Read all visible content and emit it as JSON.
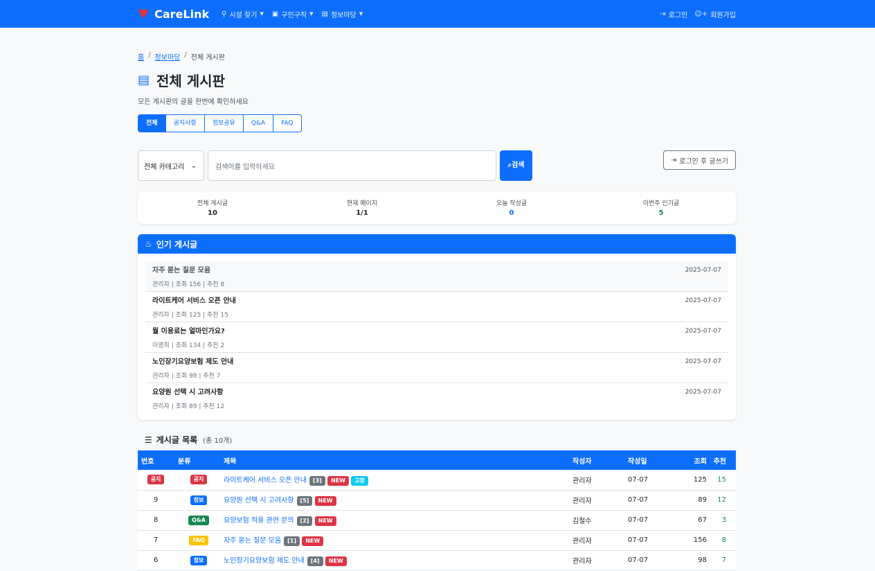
{
  "nav": {
    "brand": "CareLink",
    "items": [
      {
        "label": "시설 찾기"
      },
      {
        "label": "구인구직"
      },
      {
        "label": "정보마당"
      }
    ],
    "login": "로그인",
    "signup": "회원가입"
  },
  "breadcrumb": [
    "홈",
    "정보마당",
    "전체 게시판"
  ],
  "page": {
    "title": "전체 게시판",
    "subtitle": "모든 게시판의 글을 한번에 확인하세요"
  },
  "tabs": [
    "전체",
    "공지사항",
    "정보공유",
    "Q&A",
    "FAQ"
  ],
  "search": {
    "category": "전체 카테고리",
    "placeholder": "검색어를 입력하세요",
    "button": "검색"
  },
  "write_button": "로그인 후 글쓰기",
  "stats": [
    {
      "label": "전체 게시글",
      "value": "10",
      "color": "#212529"
    },
    {
      "label": "현재 페이지",
      "value": "1/1",
      "color": "#212529"
    },
    {
      "label": "오늘 작성글",
      "value": "0",
      "color": "#0d6efd"
    },
    {
      "label": "이번주 인기글",
      "value": "5",
      "color": "#198754"
    }
  ],
  "popular": {
    "title": "인기 게시글",
    "items": [
      {
        "title": "자주 묻는 질문 모음",
        "meta": "관리자 | 조회 156 | 추천 8",
        "date": "2025-07-07"
      },
      {
        "title": "라이트케어 서비스 오픈 안내",
        "meta": "관리자 | 조회 125 | 추천 15",
        "date": "2025-07-07"
      },
      {
        "title": "월 이용료는 얼마인가요?",
        "meta": "이영희 | 조회 134 | 추천 2",
        "date": "2025-07-07"
      },
      {
        "title": "노인장기요양보험 제도 안내",
        "meta": "관리자 | 조회 98 | 추천 7",
        "date": "2025-07-07"
      },
      {
        "title": "요양원 선택 시 고려사항",
        "meta": "관리자 | 조회 89 | 추천 12",
        "date": "2025-07-07"
      }
    ]
  },
  "list": {
    "title": "게시글 목록",
    "count": "(총 10개)",
    "columns": [
      "번호",
      "분류",
      "제목",
      "작성자",
      "작성일",
      "조회",
      "추천"
    ],
    "rows": [
      {
        "num": "공지",
        "num_badge": true,
        "cat": "공지",
        "cat_color": "red",
        "title": "라이트케어 서비스 오픈 안내",
        "comments": "[3]",
        "new": "NEW",
        "extra": "고정",
        "author": "관리자",
        "date": "07-07",
        "views": "125",
        "likes": "15"
      },
      {
        "num": "9",
        "num_badge": false,
        "cat": "정보",
        "cat_color": "blue",
        "title": "요양원 선택 시 고려사항",
        "comments": "[5]",
        "new": "NEW",
        "extra": "",
        "author": "관리자",
        "date": "07-07",
        "views": "89",
        "likes": "12"
      },
      {
        "num": "8",
        "num_badge": false,
        "cat": "Q&A",
        "cat_color": "green",
        "title": "요양보험 적용 관련 문의",
        "comments": "[2]",
        "new": "NEW",
        "extra": "",
        "author": "김철수",
        "date": "07-07",
        "views": "67",
        "likes": "3"
      },
      {
        "num": "7",
        "num_badge": false,
        "cat": "FAQ",
        "cat_color": "yellow",
        "title": "자주 묻는 질문 모음",
        "comments": "[1]",
        "new": "NEW",
        "extra": "",
        "author": "관리자",
        "date": "07-07",
        "views": "156",
        "likes": "8"
      },
      {
        "num": "6",
        "num_badge": false,
        "cat": "정보",
        "cat_color": "blue",
        "title": "노인장기요양보험 제도 안내",
        "comments": "[4]",
        "new": "NEW",
        "extra": "",
        "author": "관리자",
        "date": "07-07",
        "views": "98",
        "likes": "7"
      }
    ]
  }
}
